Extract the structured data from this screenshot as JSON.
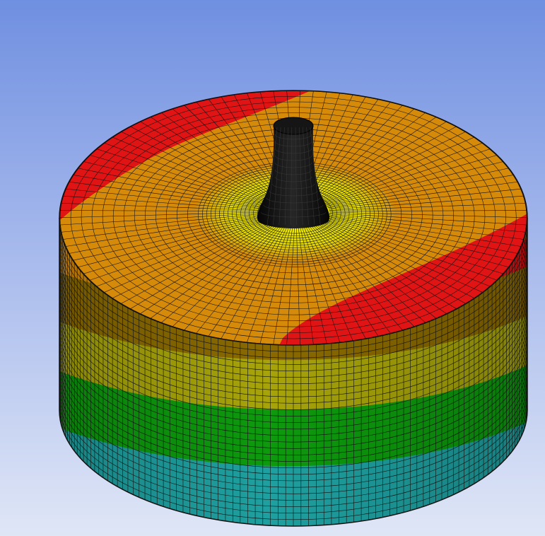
{
  "viewport": {
    "background_top": "#6f8fe0",
    "background_bottom": "#dfe6f6"
  },
  "model": {
    "mesh_line_color": "#101010",
    "stem_color": "#0b0b0b",
    "side_band_colors": [
      "#8a6a00",
      "#a7a40a",
      "#0d9a0d",
      "#1fa0a0"
    ],
    "top_face_colors": {
      "outer": "#d58a0a",
      "hot": "#e01414",
      "mid": "#e6d400",
      "center": "#f2f200"
    }
  }
}
